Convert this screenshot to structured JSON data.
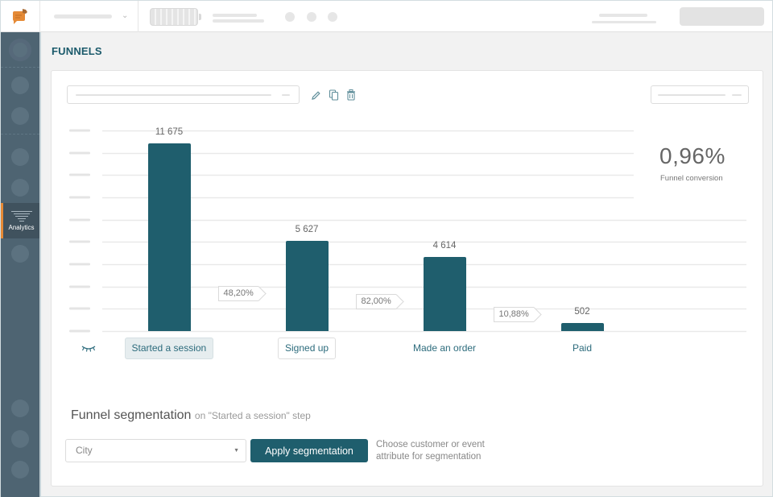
{
  "app": {
    "title": "FUNNELS",
    "accent_color": "#1f5e6d",
    "brand_color": "#e58a36"
  },
  "sidebar": {
    "active_item": {
      "label": "Analytics",
      "icon": "funnel-icon"
    }
  },
  "funnel_card": {
    "actions": [
      "edit-icon",
      "copy-icon",
      "delete-icon"
    ],
    "conversion": {
      "value": "0,96%",
      "label": "Funnel conversion"
    },
    "visibility_toggle_icon": "eye-closed-icon"
  },
  "chart_data": {
    "type": "bar",
    "title": "",
    "xlabel": "",
    "ylabel": "",
    "categories": [
      "Started a session",
      "Signed up",
      "Made an order",
      "Paid"
    ],
    "values": [
      11675,
      5627,
      4614,
      502
    ],
    "value_labels": [
      "11 675",
      "5 627",
      "4 614",
      "502"
    ],
    "step_conversions": [
      "48,20%",
      "82,00%",
      "10,88%"
    ],
    "active_category": "Started a session",
    "ylim": [
      0,
      12500
    ],
    "grid": true,
    "legend": "none"
  },
  "segmentation": {
    "title": "Funnel segmentation",
    "subtitle": "on \"Started a session\" step",
    "attribute_select": {
      "value": "City"
    },
    "apply_label": "Apply segmentation",
    "hint": "Choose customer or event attribute for segmentation"
  }
}
